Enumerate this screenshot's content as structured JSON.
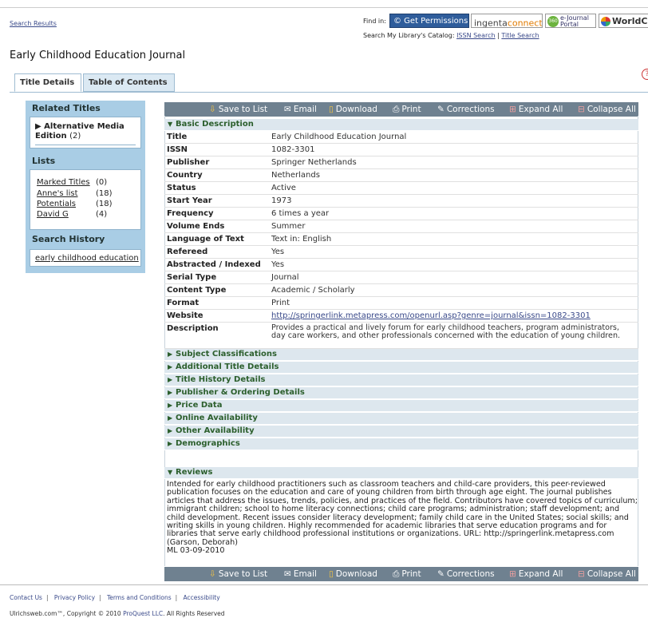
{
  "header": {
    "search_results": "Search Results",
    "find_in": "Find in:",
    "providers": {
      "ccc": "© Get Permissions",
      "ingenta_a": "ingenta",
      "ingenta_b": "connect",
      "ingenta_tm": "™",
      "ejournal_badge": "360",
      "ejournal_1": "e-Journal",
      "ejournal_2": "Portal",
      "worldcat": "WorldCat"
    },
    "catalog_prefix": "Search My Library's Catalog:",
    "issn_search": "ISSN Search",
    "catalog_sep": "|",
    "title_search": "Title Search",
    "journal_title": "Early Childhood Education Journal"
  },
  "tabs": [
    "Title Details",
    "Table of Contents"
  ],
  "help_icon": "?",
  "sidebar": {
    "related_heading": "Related Titles",
    "related_item": "Alternative Media Edition",
    "related_count": "(2)",
    "lists_heading": "Lists",
    "lists": [
      {
        "name": "Marked Titles",
        "count": "(0)"
      },
      {
        "name": "Anne's list",
        "count": "(18)"
      },
      {
        "name": "Potentials",
        "count": "(18)"
      },
      {
        "name": "David G",
        "count": "(4)"
      }
    ],
    "history_heading": "Search History",
    "history_item": "early childhood education"
  },
  "toolbar": {
    "save": "Save to List",
    "email": "Email",
    "download": "Download",
    "print": "Print",
    "corrections": "Corrections",
    "expand": "Expand All",
    "collapse": "Collapse All"
  },
  "basic": {
    "heading": "Basic Description",
    "rows": [
      {
        "label": "Title",
        "value": "Early Childhood Education Journal"
      },
      {
        "label": "ISSN",
        "value": "1082-3301"
      },
      {
        "label": "Publisher",
        "value": "Springer Netherlands"
      },
      {
        "label": "Country",
        "value": "Netherlands"
      },
      {
        "label": "Status",
        "value": "Active"
      },
      {
        "label": "Start Year",
        "value": "1973"
      },
      {
        "label": "Frequency",
        "value": "6 times a year"
      },
      {
        "label": "Volume Ends",
        "value": "Summer"
      },
      {
        "label": "Language of Text",
        "value": "Text in: English"
      },
      {
        "label": "Refereed",
        "value": "Yes"
      },
      {
        "label": "Abstracted / Indexed",
        "value": "Yes"
      },
      {
        "label": "Serial Type",
        "value": "Journal"
      },
      {
        "label": "Content Type",
        "value": "Academic / Scholarly"
      },
      {
        "label": "Format",
        "value": "Print"
      },
      {
        "label": "Website",
        "value": "http://springerlink.metapress.com/openurl.asp?genre=journal&issn=1082-3301"
      },
      {
        "label": "Description",
        "value": "Provides a practical and lively forum for early childhood teachers, program administrators, day care workers, and other professionals concerned with the education of young children."
      }
    ]
  },
  "sections": [
    "Subject Classifications",
    "Additional Title Details",
    "Title History Details",
    "Publisher & Ordering Details",
    "Price Data",
    "Online Availability",
    "Other Availability",
    "Demographics"
  ],
  "reviews": {
    "heading": "Reviews",
    "text": "Intended for early childhood practitioners such as classroom teachers and child-care providers, this peer-reviewed publication focuses on the education and care of young children from birth through age eight. The journal publishes articles that address the issues, trends, policies, and practices of the field. Contributors have covered topics of curriculum; immigrant children; school to home literacy connections; child care programs; administration; staff development; and child development. Recent issues consider literacy development; family child care in the United States; social skills; and writing skills in young children. Highly recommended for academic libraries that serve education programs and for libraries that serve early childhood professional institutions or organizations. URL: http://springerlink.metapress.com (Garson, Deborah)",
    "ml": "ML 03-09-2010"
  },
  "footer": {
    "links": [
      "Contact Us",
      "Privacy Policy",
      "Terms and Conditions",
      "Accessibility"
    ],
    "sep": "|",
    "copyright_a": "Ulrichsweb.com™, Copyright © 2010",
    "copyright_link": "ProQuest LLC",
    "copyright_b": ". All Rights Reserved"
  }
}
